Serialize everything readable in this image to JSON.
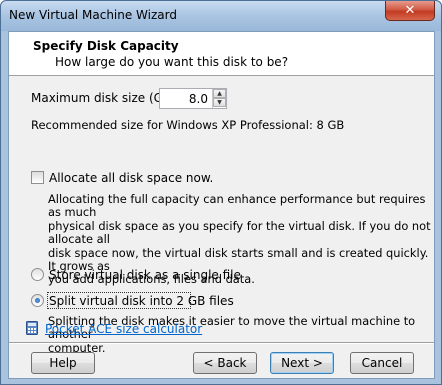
{
  "window": {
    "title": "New Virtual Machine Wizard",
    "close_glyph": "✕"
  },
  "header": {
    "title": "Specify Disk Capacity",
    "subtitle": "How large do you want this disk to be?"
  },
  "disk_size": {
    "label": "Maximum disk size (GB):",
    "value": "8.0",
    "recommended": "Recommended size for Windows XP Professional: 8 GB"
  },
  "allocate": {
    "label": "Allocate all disk space now.",
    "checked": false,
    "description": [
      "Allocating the full capacity can enhance performance but requires as much",
      "physical disk space as you specify for the virtual disk. If you do not allocate all",
      "disk space now, the virtual disk starts small and is created quickly. It grows as",
      "you add applications, files and data."
    ]
  },
  "storage_options": {
    "single": {
      "label": "Store virtual disk as a single file",
      "selected": false
    },
    "split": {
      "label": "Split virtual disk into 2 GB files",
      "selected": true,
      "description": [
        "Splitting the disk makes it easier to move the virtual machine to another",
        "computer."
      ]
    }
  },
  "link": {
    "label": "Pocket ACE size calculator",
    "icon": "calculator-icon"
  },
  "buttons": {
    "help": "Help",
    "back": "< Back",
    "next": "Next >",
    "cancel": "Cancel"
  },
  "colors": {
    "accent": "#3c7fb1",
    "link": "#0066cc",
    "title_bar": "#a9c4e2",
    "close": "#c23b22"
  }
}
